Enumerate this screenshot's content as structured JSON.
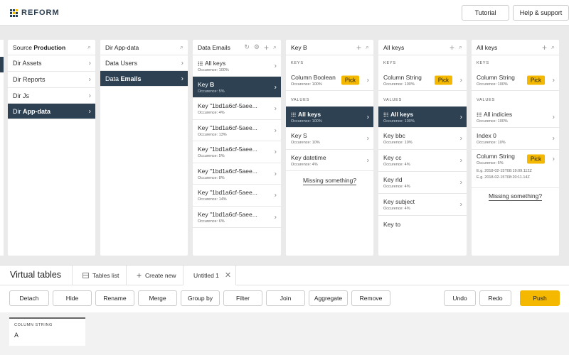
{
  "header": {
    "logo": "REFORM",
    "tutorial_label": "Tutorial",
    "help_label": "Help & support"
  },
  "columns": {
    "source": {
      "title_prefix": "Source",
      "title_name": "Production",
      "items": [
        {
          "prefix": "Dir",
          "name": "Assets"
        },
        {
          "prefix": "Dir",
          "name": "Reports"
        },
        {
          "prefix": "Dir",
          "name": "Js"
        },
        {
          "prefix": "Dir",
          "name": "App-data"
        }
      ]
    },
    "app_data": {
      "title_prefix": "Dir",
      "title_name": "App-data",
      "items": [
        {
          "prefix": "Data",
          "name": "Users"
        },
        {
          "prefix": "Data",
          "name": "Emails"
        }
      ]
    },
    "emails": {
      "title_prefix": "Data",
      "title_name": "Emails",
      "items": [
        {
          "label": "All keys",
          "occ": "Occurence: 100%"
        },
        {
          "prefix": "Key",
          "name": "B",
          "occ": "Occurence: 5%"
        },
        {
          "label": "Key \"1bd1a6cf-5aee...",
          "occ": "Occurence: 4%"
        },
        {
          "label": "Key \"1bd1a6cf-5aee...",
          "occ": "Occurence: 13%"
        },
        {
          "label": "Key \"1bd1a6cf-5aee...",
          "occ": "Occurence: 5%"
        },
        {
          "label": "Key \"1bd1a6cf-5aee...",
          "occ": "Occurence: 8%"
        },
        {
          "label": "Key \"1bd1a6cf-5aee...",
          "occ": "Occurence: 14%"
        },
        {
          "label": "Key \"1bd1a6cf-5aee...",
          "occ": "Occurence: 6%"
        }
      ]
    },
    "key_b": {
      "title_prefix": "Key",
      "title_name": "B",
      "keys_label": "KEYS",
      "key_item": {
        "prefix": "Column",
        "name": "Boolean",
        "occ": "Occurence: 100%",
        "pick": "Pick"
      },
      "values_label": "VALUES",
      "values": [
        {
          "label": "All keys",
          "occ": "Occurence: 100%"
        },
        {
          "label": "Key S",
          "occ": "Occurence: 10%"
        },
        {
          "label": "Key datetime",
          "occ": "Occurence: 4%"
        }
      ],
      "missing": "Missing something?"
    },
    "all_keys_1": {
      "title": "All keys",
      "keys_label": "KEYS",
      "key_item": {
        "prefix": "Column",
        "name": "String",
        "occ": "Occurence: 100%",
        "pick": "Pick"
      },
      "values_label": "VALUES",
      "values": [
        {
          "label": "All keys",
          "occ": "Occurence: 100%"
        },
        {
          "label": "Key bbc",
          "occ": "Occurence: 10%"
        },
        {
          "label": "Key cc",
          "occ": "Occurence: 4%"
        },
        {
          "label": "Key rld",
          "occ": "Occurence: 4%"
        },
        {
          "label": "Key subject",
          "occ": "Occurence: 4%"
        },
        {
          "label": "Key to",
          "occ": ""
        }
      ]
    },
    "all_keys_2": {
      "title": "All keys",
      "keys_label": "KEYS",
      "key_item": {
        "prefix": "Column",
        "name": "String",
        "occ": "Occurence: 100%",
        "pick": "Pick"
      },
      "values_label": "VALUES",
      "values": [
        {
          "label": "All indicies",
          "occ": "Occurence: 100%"
        },
        {
          "label": "Index 0",
          "occ": "Occurence: 10%"
        },
        {
          "label": "Column String",
          "occ": "Occurence: 6%",
          "pick": "Pick"
        }
      ],
      "examples": [
        "E.g. 2018-02-15T08:19:09.112Z",
        "E.g. 2018-02-15T08:20:11.14Z"
      ],
      "missing": "Missing something?"
    }
  },
  "virtual_tables": {
    "title": "Virtual tables",
    "tabs": {
      "tables_list": "Tables list",
      "create_new": "Create new",
      "untitled": "Untitled 1"
    },
    "tools": {
      "detach": "Detach",
      "hide": "Hide",
      "rename": "Rename",
      "merge": "Merge",
      "group_by": "Group by",
      "filter": "Filter",
      "join": "Join",
      "aggregate": "Aggregate",
      "remove": "Remove",
      "undo": "Undo",
      "redo": "Redo",
      "push": "Push"
    },
    "card": {
      "label": "COLUMN STRING",
      "value": "A"
    }
  },
  "colors": {
    "selected": "#2d4152",
    "accent": "#f5b800"
  }
}
